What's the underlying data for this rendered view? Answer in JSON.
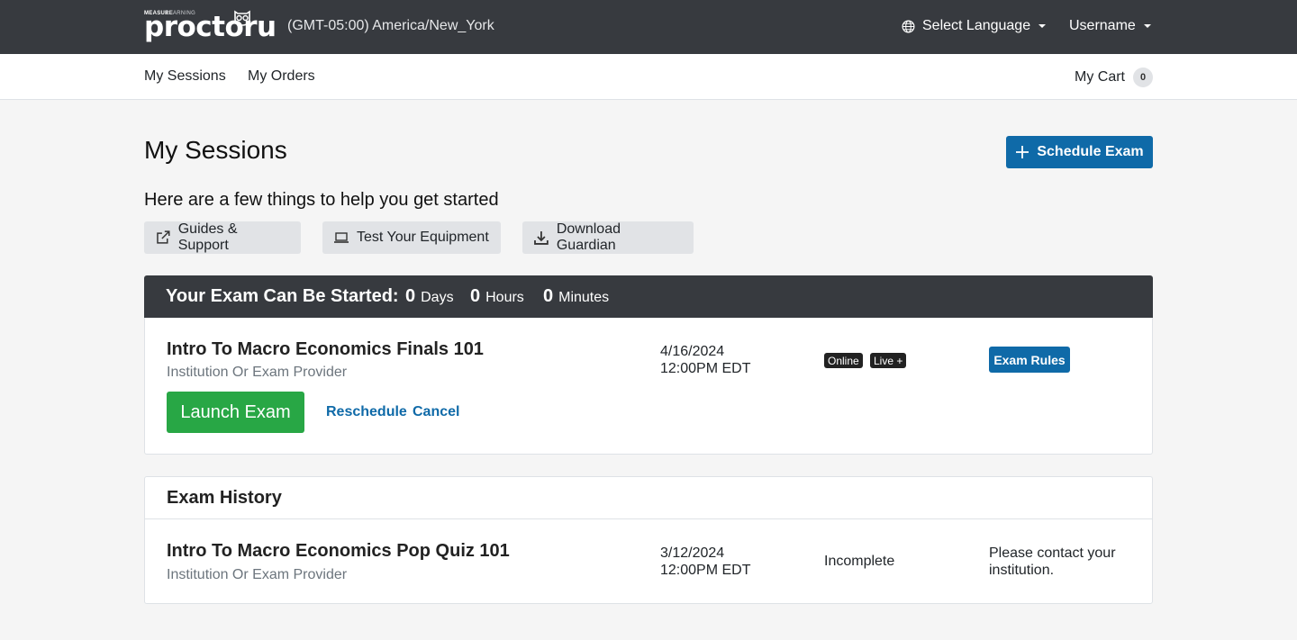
{
  "header": {
    "logo_brand": "MEASURE",
    "logo_sub": "LEARNING",
    "logo_wordmark": "proctoru",
    "timezone": "(GMT-05:00) America/New_York",
    "language_label": "Select Language",
    "username": "Username"
  },
  "subnav": {
    "my_sessions": "My Sessions",
    "my_orders": "My Orders",
    "cart_label": "My Cart",
    "cart_count": "0"
  },
  "main": {
    "title": "My Sessions",
    "schedule_label": "Schedule Exam",
    "helper_text": "Here are a few things to help you get started",
    "help_buttons": [
      {
        "label": "Guides & Support",
        "icon": "external-link-icon"
      },
      {
        "label": "Test Your Equipment",
        "icon": "laptop-icon"
      },
      {
        "label": "Download Guardian",
        "icon": "download-icon"
      }
    ]
  },
  "upcoming": {
    "timer_label": "Your Exam Can Be Started:",
    "days": "0",
    "days_label": "Days",
    "hours": "0",
    "hours_label": "Hours",
    "minutes": "0",
    "minutes_label": "Minutes",
    "exam_title": "Intro To Macro Economics Finals 101",
    "provider": "Institution Or Exam Provider",
    "date": "4/16/2024",
    "time": "12:00PM EDT",
    "tags": [
      "Online",
      "Live +"
    ],
    "rules_label": "Exam Rules",
    "launch_label": "Launch Exam",
    "reschedule_label": "Reschedule",
    "cancel_label": "Cancel"
  },
  "history": {
    "title": "Exam History",
    "exam_title": "Intro To Macro Economics Pop Quiz 101",
    "provider": "Institution Or Exam Provider",
    "date": "3/12/2024",
    "time": "12:00PM EDT",
    "status": "Incomplete",
    "note": "Please contact your institution."
  },
  "colors": {
    "topbar": "#373a3f",
    "primary": "#0f6aa8",
    "success": "#28a745"
  }
}
